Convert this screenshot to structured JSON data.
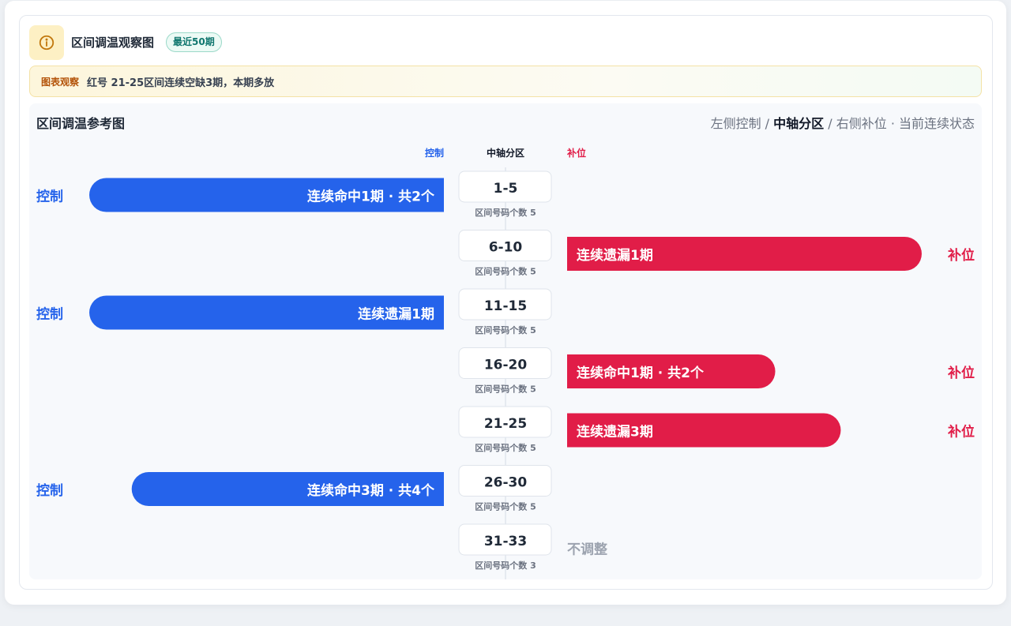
{
  "header": {
    "title": "区间调温观察图",
    "badge": "最近50期",
    "icon": "info-icon"
  },
  "observation": {
    "label": "图表观察",
    "text": "红号 21-25区间连续空缺3期，本期多放"
  },
  "chart_header": {
    "title": "区间调温参考图",
    "subtitle_part1": "左侧控制 / ",
    "subtitle_part2": "中轴分区",
    "subtitle_part3": " / 右侧补位 · 当前连续状态"
  },
  "colors": {
    "control": "#2563eb",
    "fill": "#e11d48",
    "neutral": "#9ca3af"
  },
  "chart_data": {
    "type": "bar",
    "column_headers": {
      "left": "控制",
      "center": "中轴分区",
      "right": "补位"
    },
    "count_label_prefix": "区间号码个数",
    "neutral_label": "不调整",
    "rows": [
      {
        "range": "1-5",
        "count": 5,
        "side": "left",
        "side_label": "控制",
        "text": "连续命中1期 · 共2个",
        "length": 0.92
      },
      {
        "range": "6-10",
        "count": 5,
        "side": "right",
        "side_label": "补位",
        "text": "连续遗漏1期",
        "length": 0.92
      },
      {
        "range": "11-15",
        "count": 5,
        "side": "left",
        "side_label": "控制",
        "text": "连续遗漏1期",
        "length": 0.92
      },
      {
        "range": "16-20",
        "count": 5,
        "side": "right",
        "side_label": "补位",
        "text": "连续命中1期 · 共2个",
        "length": 0.54
      },
      {
        "range": "21-25",
        "count": 5,
        "side": "right",
        "side_label": "补位",
        "text": "连续遗漏3期",
        "length": 0.71
      },
      {
        "range": "26-30",
        "count": 5,
        "side": "left",
        "side_label": "控制",
        "text": "连续命中3期 · 共4个",
        "length": 0.81
      },
      {
        "range": "31-33",
        "count": 3,
        "side": "none",
        "side_label": "",
        "text": "",
        "length": 0
      }
    ]
  }
}
